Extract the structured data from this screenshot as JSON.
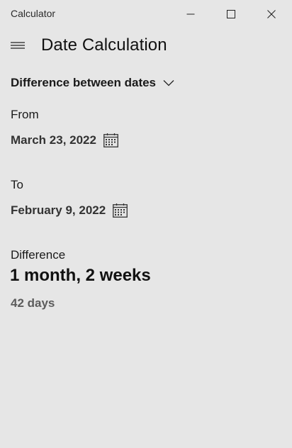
{
  "window": {
    "app_title": "Calculator",
    "controls": {
      "minimize": "minimize-icon",
      "maximize": "maximize-icon",
      "close": "close-icon"
    }
  },
  "header": {
    "menu_icon": "hamburger-menu-icon",
    "title": "Date Calculation"
  },
  "mode": {
    "selected": "Difference between dates",
    "icon": "chevron-down-icon"
  },
  "from": {
    "label": "From",
    "date": "March 23, 2022",
    "icon": "calendar-icon"
  },
  "to": {
    "label": "To",
    "date": "February 9, 2022",
    "icon": "calendar-icon"
  },
  "difference": {
    "label": "Difference",
    "result": "1 month, 2 weeks",
    "days": "42 days"
  },
  "colors": {
    "background": "#e6e6e6",
    "text": "#1a1a1a",
    "secondary_text": "#5c5c5c"
  }
}
